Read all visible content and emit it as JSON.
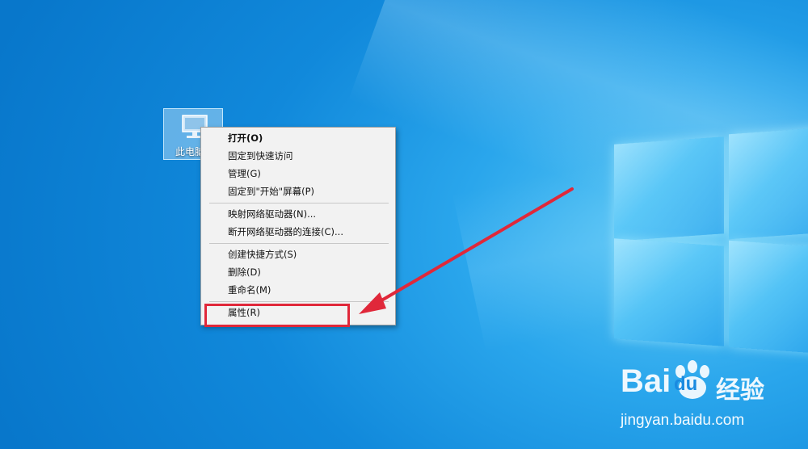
{
  "desktop": {
    "icon_label": "此电脑"
  },
  "context_menu": {
    "items": [
      {
        "label": "打开(O)",
        "bold": true
      },
      {
        "label": "固定到快速访问"
      },
      {
        "label": "管理(G)"
      },
      {
        "label": "固定到\"开始\"屏幕(P)"
      },
      {
        "label": "映射网络驱动器(N)..."
      },
      {
        "label": "断开网络驱动器的连接(C)..."
      },
      {
        "label": "创建快捷方式(S)"
      },
      {
        "label": "删除(D)"
      },
      {
        "label": "重命名(M)"
      },
      {
        "label": "属性(R)"
      }
    ]
  },
  "annotation": {
    "highlight_color": "#e0283a"
  },
  "watermark": {
    "brand_left": "Bai",
    "brand_right": "du",
    "product": "经验",
    "url": "jingyan.baidu.com"
  },
  "icons": [
    "pc-icon",
    "baidu-paw-icon"
  ]
}
